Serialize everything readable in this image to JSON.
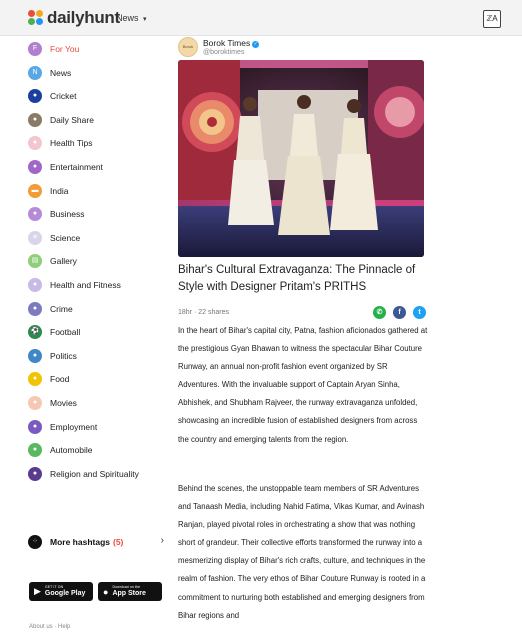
{
  "header": {
    "logo_text": "dailyhunt",
    "logo_colors": [
      "#e94b3c",
      "#f5a623",
      "#4caf50",
      "#2196f3"
    ],
    "nav_news": "News",
    "nav_news_caret": "▾",
    "lang_label": "ℤA"
  },
  "sidebar": {
    "items": [
      {
        "label": "For You",
        "icon": "for-you-icon",
        "glyph": "F",
        "color": "#b07fd0",
        "active": true
      },
      {
        "label": "News",
        "icon": "news-icon",
        "glyph": "N",
        "color": "#5aa7e6",
        "active": false
      },
      {
        "label": "Cricket",
        "icon": "cricket-icon",
        "glyph": "●",
        "color": "#1a3f9c",
        "active": false
      },
      {
        "label": "Daily Share",
        "icon": "daily-share-icon",
        "glyph": "●",
        "color": "#8a7b66",
        "active": false
      },
      {
        "label": "Health Tips",
        "icon": "health-tips-icon",
        "glyph": "●",
        "color": "#f3c7cf",
        "active": false
      },
      {
        "label": "Entertainment",
        "icon": "entertainment-icon",
        "glyph": "●",
        "color": "#a066c9",
        "active": false
      },
      {
        "label": "India",
        "icon": "india-flag-icon",
        "glyph": "▬",
        "color": "#f29b38",
        "active": false
      },
      {
        "label": "Business",
        "icon": "business-icon",
        "glyph": "●",
        "color": "#b58ad6",
        "active": false
      },
      {
        "label": "Science",
        "icon": "science-icon",
        "glyph": "✳",
        "color": "#d9d4e8",
        "active": false
      },
      {
        "label": "Gallery",
        "icon": "gallery-icon",
        "glyph": "▤",
        "color": "#8fce7a",
        "active": false
      },
      {
        "label": "Health and Fitness",
        "icon": "health-fitness-icon",
        "glyph": "●",
        "color": "#c9b9e6",
        "active": false
      },
      {
        "label": "Crime",
        "icon": "crime-icon",
        "glyph": "●",
        "color": "#7d7bbf",
        "active": false
      },
      {
        "label": "Football",
        "icon": "football-icon",
        "glyph": "⚽",
        "color": "#2d8a4d",
        "active": false
      },
      {
        "label": "Politics",
        "icon": "politics-icon",
        "glyph": "●",
        "color": "#3f87c8",
        "active": false
      },
      {
        "label": "Food",
        "icon": "food-icon",
        "glyph": "●",
        "color": "#f2c300",
        "active": false
      },
      {
        "label": "Movies",
        "icon": "movies-icon",
        "glyph": "●",
        "color": "#f4c8b2",
        "active": false
      },
      {
        "label": "Employment",
        "icon": "employment-icon",
        "glyph": "●",
        "color": "#7a5ac2",
        "active": false
      },
      {
        "label": "Automobile",
        "icon": "automobile-icon",
        "glyph": "●",
        "color": "#58b95e",
        "active": false
      },
      {
        "label": "Religion and Spirituality",
        "icon": "religion-icon",
        "glyph": "●",
        "color": "#5a3c8e",
        "active": false
      }
    ],
    "more_hashtags_label": "More hashtags",
    "more_hashtags_count": "(5)",
    "google_play_small": "GET IT ON",
    "google_play_big": "Google Play",
    "app_store_small": "Download on the",
    "app_store_big": "App Store",
    "footer_about": "About us",
    "footer_sep": "·",
    "footer_help": "Help"
  },
  "article": {
    "source_name": "Borok Times",
    "source_handle": "@boroktimes",
    "source_logo_text": "Borok",
    "headline": "Bihar's Cultural Extravaganza: The Pinnacle of Style with Designer Pritam's PRITHS",
    "time": "18hr",
    "shares": "22 shares",
    "meta_sep": "·",
    "share_icons": [
      {
        "name": "whatsapp-share-icon",
        "color": "#25b14a",
        "glyph": "✆"
      },
      {
        "name": "facebook-share-icon",
        "color": "#3b5998",
        "glyph": "f"
      },
      {
        "name": "twitter-share-icon",
        "color": "#1da1f2",
        "glyph": "t"
      }
    ],
    "paragraph_1": "In the heart of Bihar's capital city, Patna, fashion aficionados gathered at the prestigious Gyan Bhawan to witness the spectacular Bihar Couture Runway, an annual non-profit fashion event organized by SR Adventures. With the invaluable support of Captain Aryan Sinha, Abhishek, and Shubham Rajveer, the runway extravaganza unfolded, showcasing an incredible fusion of established designers from across the country and emerging talents from the region.",
    "paragraph_2": "Behind the scenes, the unstoppable team members of SR Adventures and Tanaash Media, including Nahid Fatima, Vikas Kumar, and Avinash Ranjan, played pivotal roles in orchestrating a show that was nothing short of grandeur. Their collective efforts transformed the runway into a mesmerizing display of Bihar's rich crafts, culture, and techniques in the realm of fashion. The very ethos of Bihar Couture Runway is rooted in a commitment to nurturing both established and emerging designers from Bihar regions and"
  }
}
